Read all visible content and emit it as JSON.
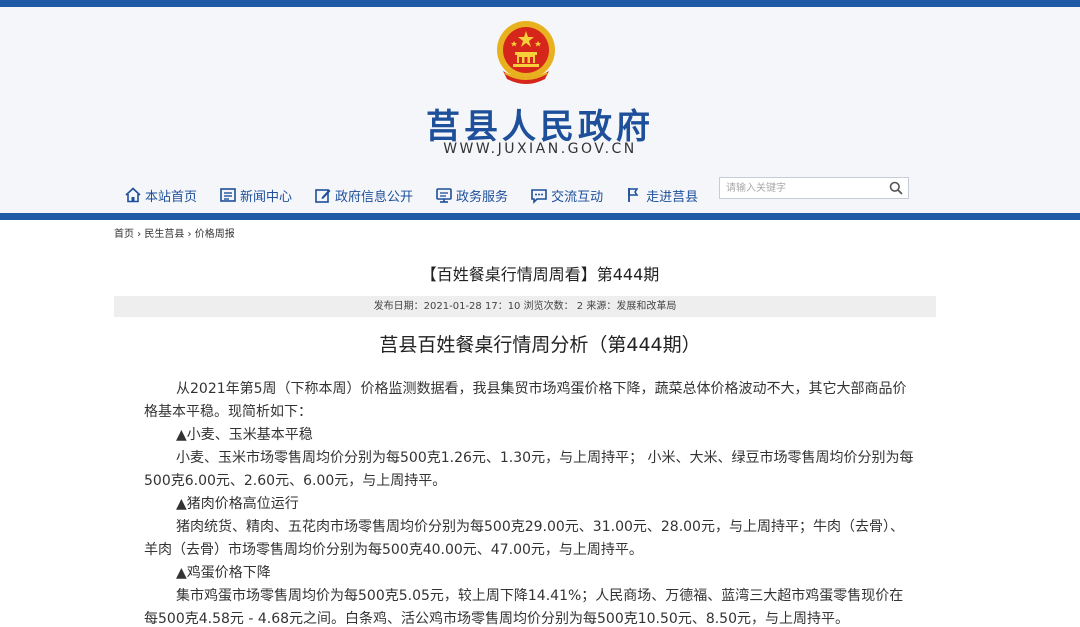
{
  "site": {
    "title": "莒县人民政府",
    "url": "WWW.JUXIAN.GOV.CN"
  },
  "nav": [
    {
      "label": "本站首页",
      "icon": "home-icon"
    },
    {
      "label": "新闻中心",
      "icon": "news-icon"
    },
    {
      "label": "政府信息公开",
      "icon": "edit-icon"
    },
    {
      "label": "政务服务",
      "icon": "service-icon"
    },
    {
      "label": "交流互动",
      "icon": "chat-icon"
    },
    {
      "label": "走进莒县",
      "icon": "flag-icon"
    }
  ],
  "search": {
    "placeholder": "请输入关键字"
  },
  "breadcrumb": {
    "home": "首页",
    "sep1": " › ",
    "section": "民生莒县",
    "sep2": " › ",
    "current": "价格周报"
  },
  "article": {
    "title": "【百姓餐桌行情周周看】第444期",
    "meta": "发布日期：2021-01-28 17：10 浏览次数： 2 来源：发展和改革局",
    "content_title": "莒县百姓餐桌行情周分析（第444期）",
    "paragraphs": [
      {
        "type": "indent",
        "text": "从2021年第5周（下称本周）价格监测数据看，我县集贸市场鸡蛋价格下降，蔬菜总体价格波动不大，其它大部商品价格基本平稳。现简析如下："
      },
      {
        "type": "head",
        "text": "▲小麦、玉米基本平稳"
      },
      {
        "type": "indent",
        "text": "小麦、玉米市场零售周均价分别为每500克1.26元、1.30元，与上周持平； 小米、大米、绿豆市场零售周均价分别为每500克6.00元、2.60元、6.00元，与上周持平。"
      },
      {
        "type": "head",
        "text": "▲猪肉价格高位运行"
      },
      {
        "type": "indent",
        "text": "猪肉统货、精肉、五花肉市场零售周均价分别为每500克29.00元、31.00元、28.00元，与上周持平；牛肉（去骨）、羊肉（去骨）市场零售周均价分别为每500克40.00元、47.00元，与上周持平。"
      },
      {
        "type": "head",
        "text": "▲鸡蛋价格下降"
      },
      {
        "type": "indent",
        "text": "集市鸡蛋市场零售周均价为每500克5.05元，较上周下降14.41%；人民商场、万德福、蓝湾三大超市鸡蛋零售现价在每500克4.58元 - 4.68元之间。白条鸡、活公鸡市场零售周均价分别为每500克10.50元、8.50元，与上周持平。"
      }
    ]
  },
  "colors": {
    "brand": "#1d4f9a",
    "bar": "#1f5aa6",
    "header_bg": "#f5f6f9",
    "meta_bg": "#eeeeee"
  }
}
